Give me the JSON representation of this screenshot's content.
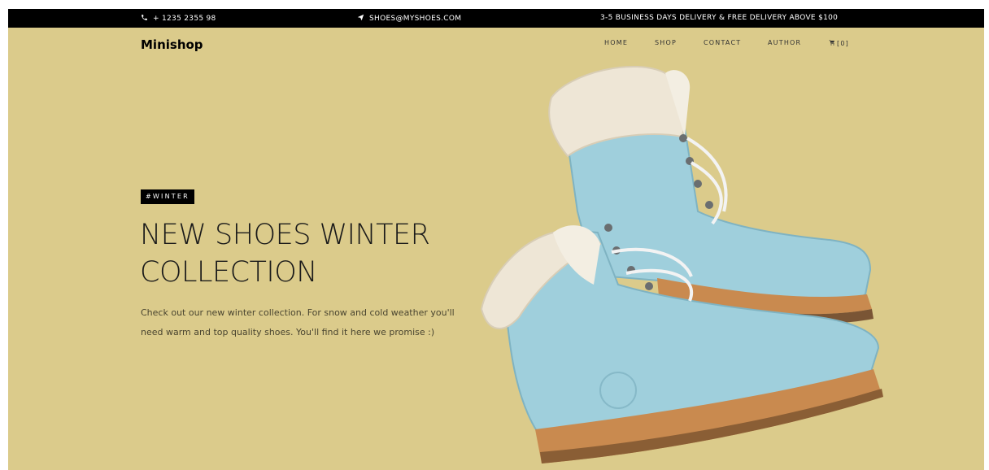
{
  "topbar": {
    "phone": "+ 1235 2355 98",
    "email": "SHOES@MYSHOES.COM",
    "delivery": "3-5 BUSINESS DAYS DELIVERY & FREE DELIVERY ABOVE $100"
  },
  "header": {
    "brand": "Minishop",
    "nav": {
      "home": "HOME",
      "shop": "SHOP",
      "contact": "CONTACT",
      "author": "AUTHOR",
      "cart": "[0]"
    }
  },
  "hero": {
    "tag": "#WINTER",
    "headline_line1": "NEW SHOES WINTER",
    "headline_line2": "COLLECTION",
    "desc_line1": "Check out our new winter collection. For snow and cold weather you'll",
    "desc_line2": "need warm and top quality shoes. You'll find it here we promise :)"
  },
  "colors": {
    "hero_background": "#dbcb8b",
    "topbar_background": "#000000",
    "boot_leather": "#9fcfdc",
    "boot_fur": "#eee6d6",
    "boot_sole": "#c98a4f"
  },
  "icons": {
    "phone": "phone-icon",
    "email": "paper-plane-icon",
    "cart": "cart-icon"
  }
}
